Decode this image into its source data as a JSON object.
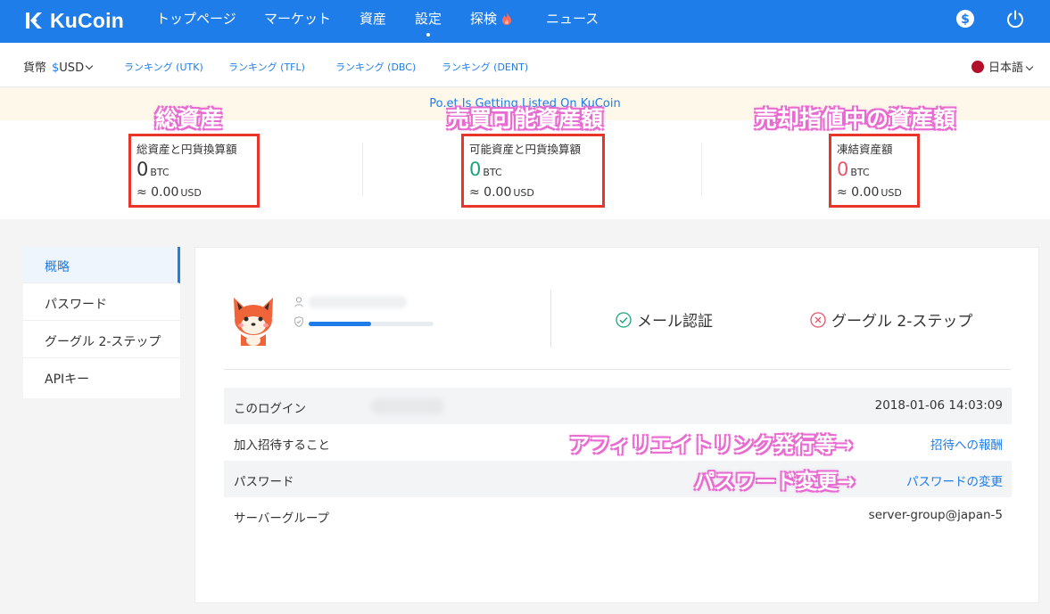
{
  "brand": {
    "name": "KuCoin",
    "color": "#1f7dea"
  },
  "nav": {
    "items": [
      {
        "label": "トップページ"
      },
      {
        "label": "マーケット"
      },
      {
        "label": "資産"
      },
      {
        "label": "設定",
        "active": true
      },
      {
        "label": "探検",
        "icon": "flame-icon"
      },
      {
        "label": "ニュース"
      }
    ],
    "right_icons": [
      "dollar-icon",
      "power-icon"
    ]
  },
  "subbar": {
    "currency_label": "貨幣",
    "currency_symbol": "$",
    "currency_value": "USD",
    "rankings": [
      "ランキング (UTK)",
      "ランキング (TFL)",
      "ランキング (DBC)",
      "ランキング (DENT)"
    ],
    "language": "日本語"
  },
  "banner": {
    "text": "Po.et Is Getting Listed On KuCoin"
  },
  "balances": [
    {
      "label": "総資産と円貨換算額",
      "value": "0",
      "unit": "BTC",
      "fiat": "≈ 0.00",
      "fiat_unit": "USD",
      "value_color": "#333333"
    },
    {
      "label": "可能資産と円貨換算額",
      "value": "0",
      "unit": "BTC",
      "fiat": "≈ 0.00",
      "fiat_unit": "USD",
      "value_color": "#1aa37a"
    },
    {
      "label": "凍結資産額",
      "value": "0",
      "unit": "BTC",
      "fiat": "≈ 0.00",
      "fiat_unit": "USD",
      "value_color": "#e8556a"
    }
  ],
  "annotations": {
    "total_assets": "総資産",
    "tradable_assets": "売買可能資産額",
    "frozen_assets": "売却指値中の資産額",
    "affiliate": "アフィリエイトリンク発行等→",
    "password_change": "パスワード変更→"
  },
  "sidebar": {
    "items": [
      {
        "label": "概略",
        "active": true
      },
      {
        "label": "パスワード"
      },
      {
        "label": "グーグル 2-ステップ"
      },
      {
        "label": "APIキー"
      }
    ]
  },
  "profile": {
    "security_progress": 0.5,
    "email_verify": "メール認証",
    "google_2step": "グーグル 2-ステップ"
  },
  "rows": [
    {
      "label": "このログイン",
      "value": "2018-01-06 14:03:09"
    },
    {
      "label": "加入招待すること",
      "link": "招待への報酬"
    },
    {
      "label": "パスワード",
      "link": "パスワードの変更"
    },
    {
      "label": "サーバーグループ",
      "value": "server-group@japan-5"
    }
  ]
}
